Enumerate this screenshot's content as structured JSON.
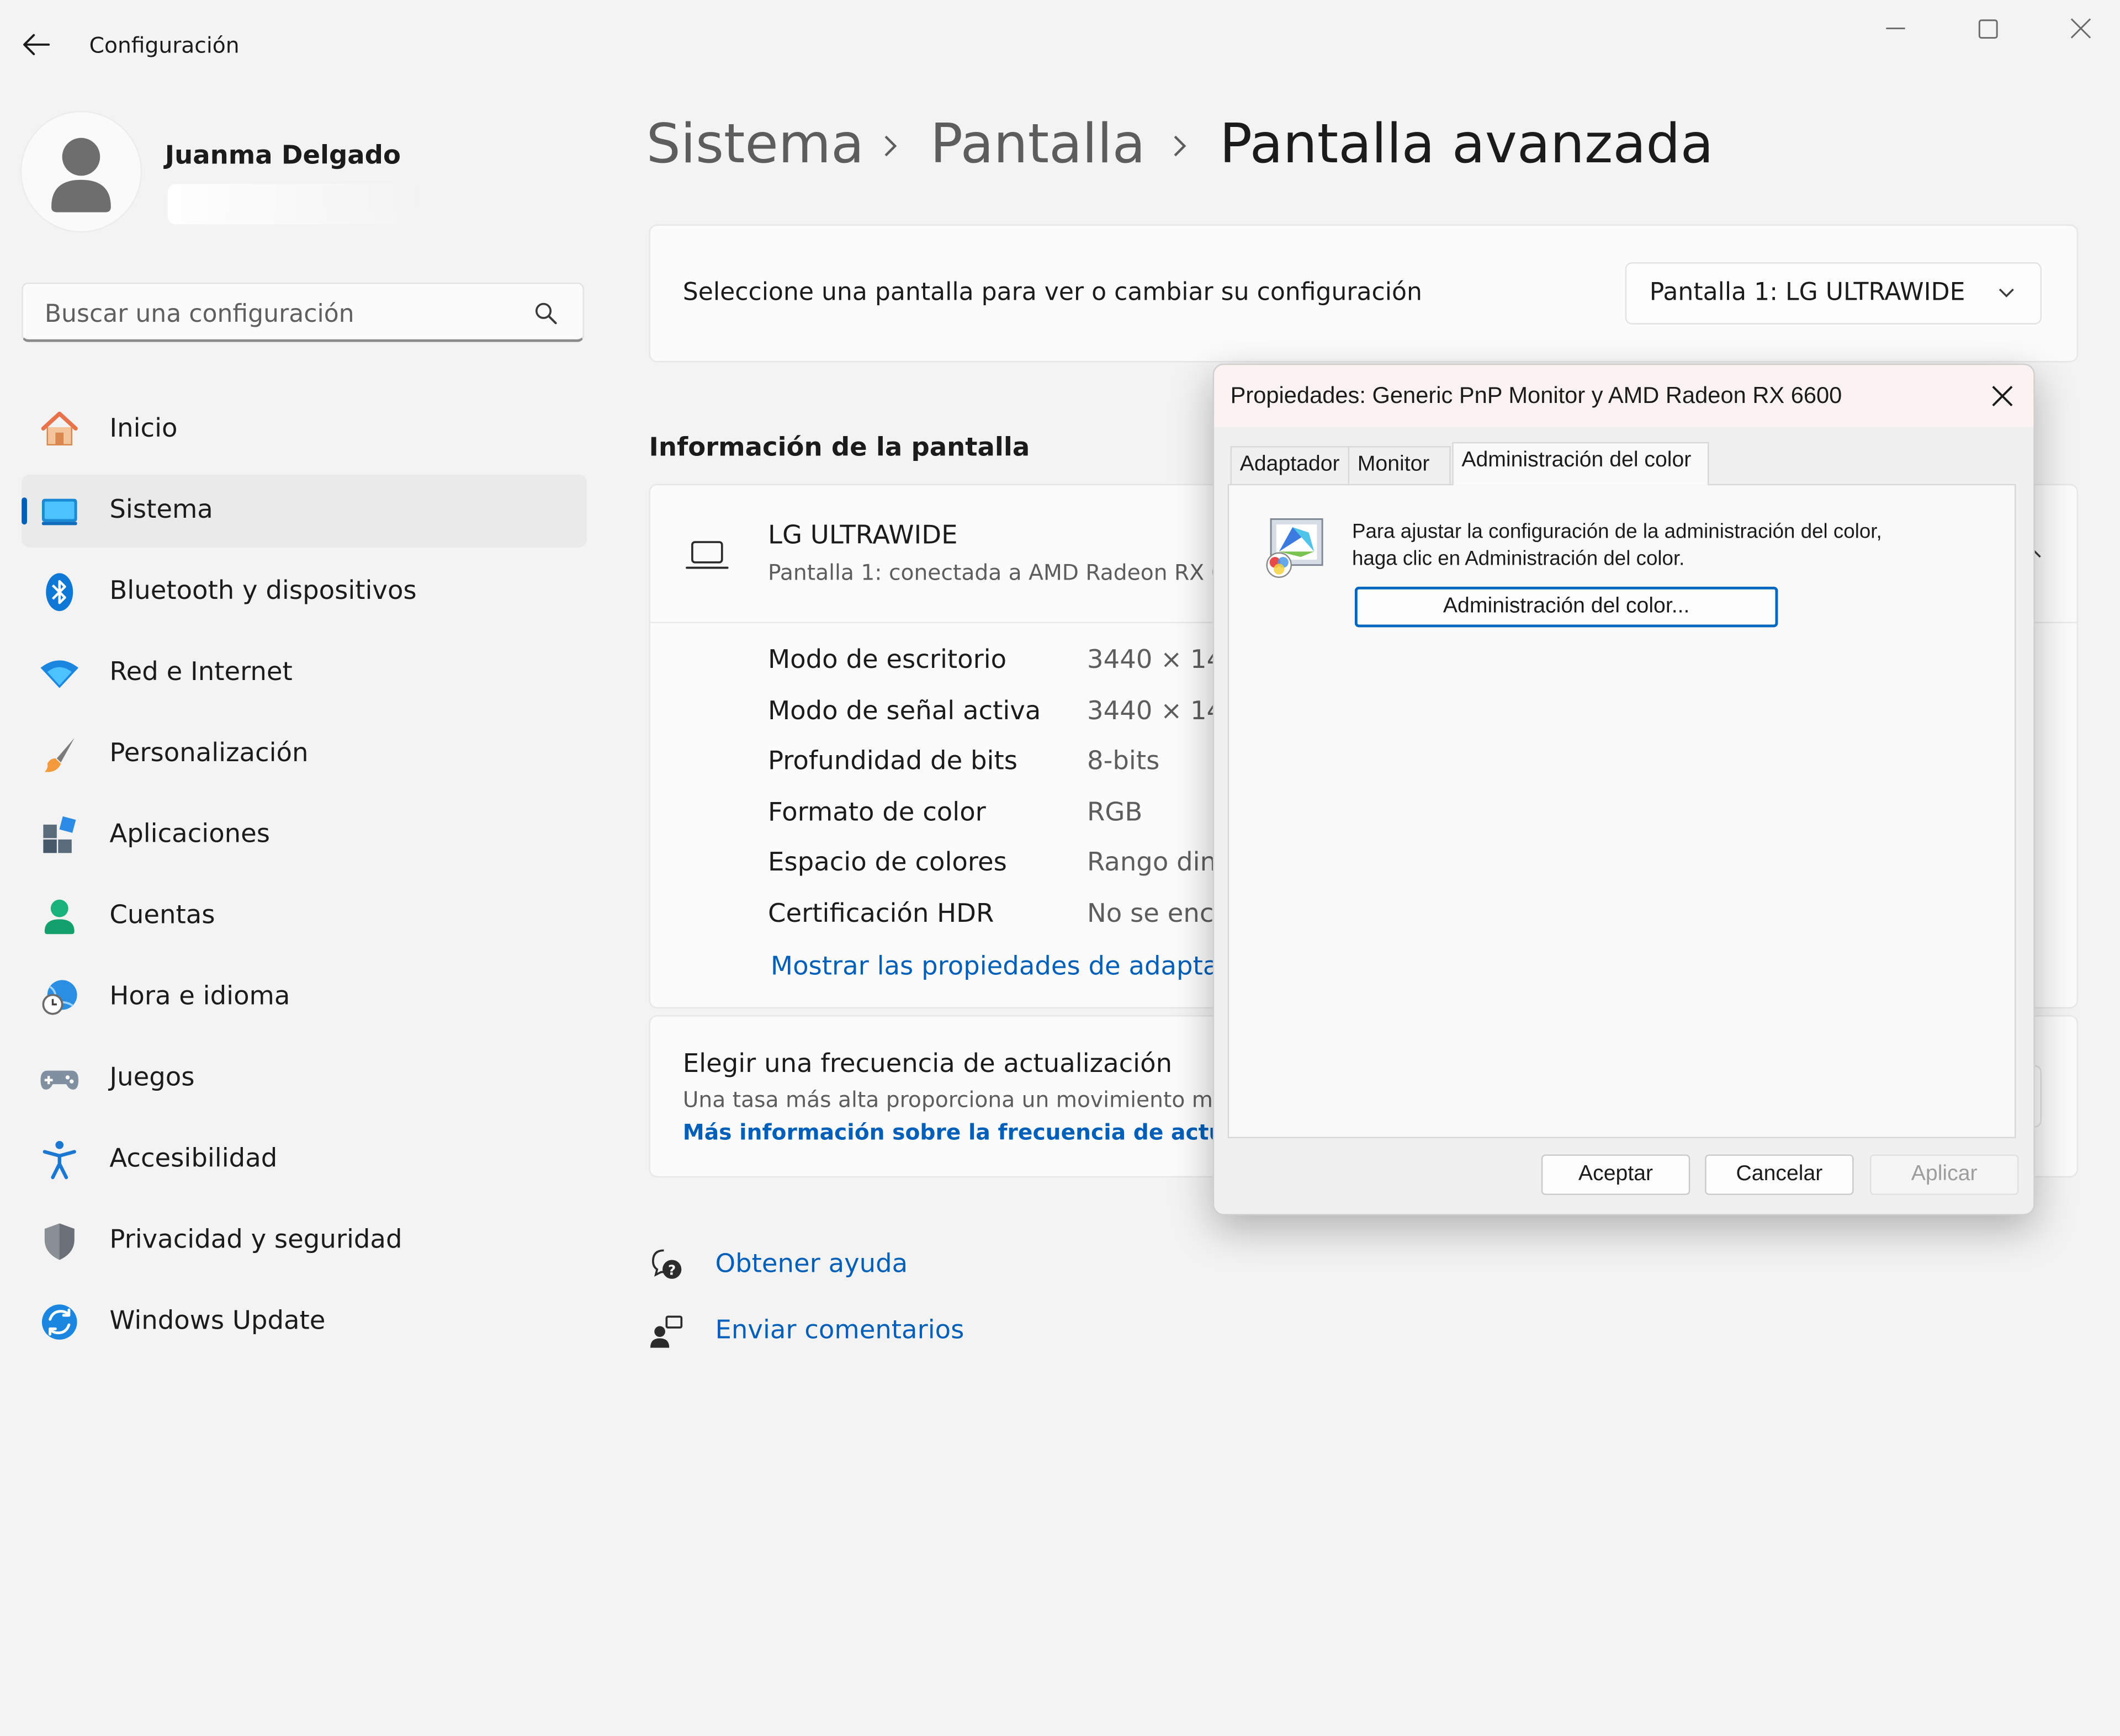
{
  "window": {
    "app_title": "Configuración",
    "controls": [
      "minimize-icon",
      "maximize-icon",
      "close-icon"
    ]
  },
  "user": {
    "name": "Juanma Delgado"
  },
  "search": {
    "placeholder": "Buscar una configuración"
  },
  "sidebar": {
    "items": [
      {
        "label": "Inicio",
        "icon": "home-icon"
      },
      {
        "label": "Sistema",
        "icon": "system-icon",
        "active": true
      },
      {
        "label": "Bluetooth y dispositivos",
        "icon": "bluetooth-icon"
      },
      {
        "label": "Red e Internet",
        "icon": "wifi-icon"
      },
      {
        "label": "Personalización",
        "icon": "brush-icon"
      },
      {
        "label": "Aplicaciones",
        "icon": "apps-icon"
      },
      {
        "label": "Cuentas",
        "icon": "account-icon"
      },
      {
        "label": "Hora e idioma",
        "icon": "time-language-icon"
      },
      {
        "label": "Juegos",
        "icon": "gamepad-icon"
      },
      {
        "label": "Accesibilidad",
        "icon": "accessibility-icon"
      },
      {
        "label": "Privacidad y seguridad",
        "icon": "shield-icon"
      },
      {
        "label": "Windows Update",
        "icon": "update-icon"
      }
    ]
  },
  "breadcrumb": [
    "Sistema",
    "Pantalla",
    "Pantalla avanzada"
  ],
  "display_select": {
    "label": "Seleccione una pantalla para ver o cambiar su configuración",
    "selected": "Pantalla 1: LG ULTRAWIDE"
  },
  "display_info": {
    "section_title": "Información de la pantalla",
    "monitor_name": "LG ULTRAWIDE",
    "monitor_sub": "Pantalla 1: conectada a AMD Radeon RX 6600",
    "rows": [
      {
        "label": "Modo de escritorio",
        "value": "3440 × 1440"
      },
      {
        "label": "Modo de señal activa",
        "value": "3440 × 1440"
      },
      {
        "label": "Profundidad de bits",
        "value": "8-bits"
      },
      {
        "label": "Formato de color",
        "value": "RGB"
      },
      {
        "label": "Espacio de colores",
        "value": "Rango dinámico estándar (SDR)"
      },
      {
        "label": "Certificación HDR",
        "value": "No se encontró"
      }
    ],
    "adapter_link": "Mostrar las propiedades de adaptador de pantalla para Pantalla 1"
  },
  "refresh": {
    "title": "Elegir una frecuencia de actualización",
    "desc": "Una tasa más alta proporciona un movimiento más fluido, pero también usa más energía",
    "link": "Más información sobre la frecuencia de actualización"
  },
  "help": {
    "get_help": "Obtener ayuda",
    "feedback": "Enviar comentarios"
  },
  "dialog": {
    "title": "Propiedades: Generic PnP Monitor y AMD Radeon RX 6600",
    "tabs": [
      "Adaptador",
      "Monitor",
      "Administración del color"
    ],
    "active_tab": 2,
    "description_line1": "Para ajustar la configuración de la administración del color,",
    "description_line2": "haga clic en Administración del color.",
    "color_button": "Administración del color...",
    "ok": "Aceptar",
    "cancel": "Cancelar",
    "apply": "Aplicar"
  },
  "colors": {
    "accent": "#005fb8",
    "background": "#f3f3f3",
    "card": "#fbfbfb"
  }
}
